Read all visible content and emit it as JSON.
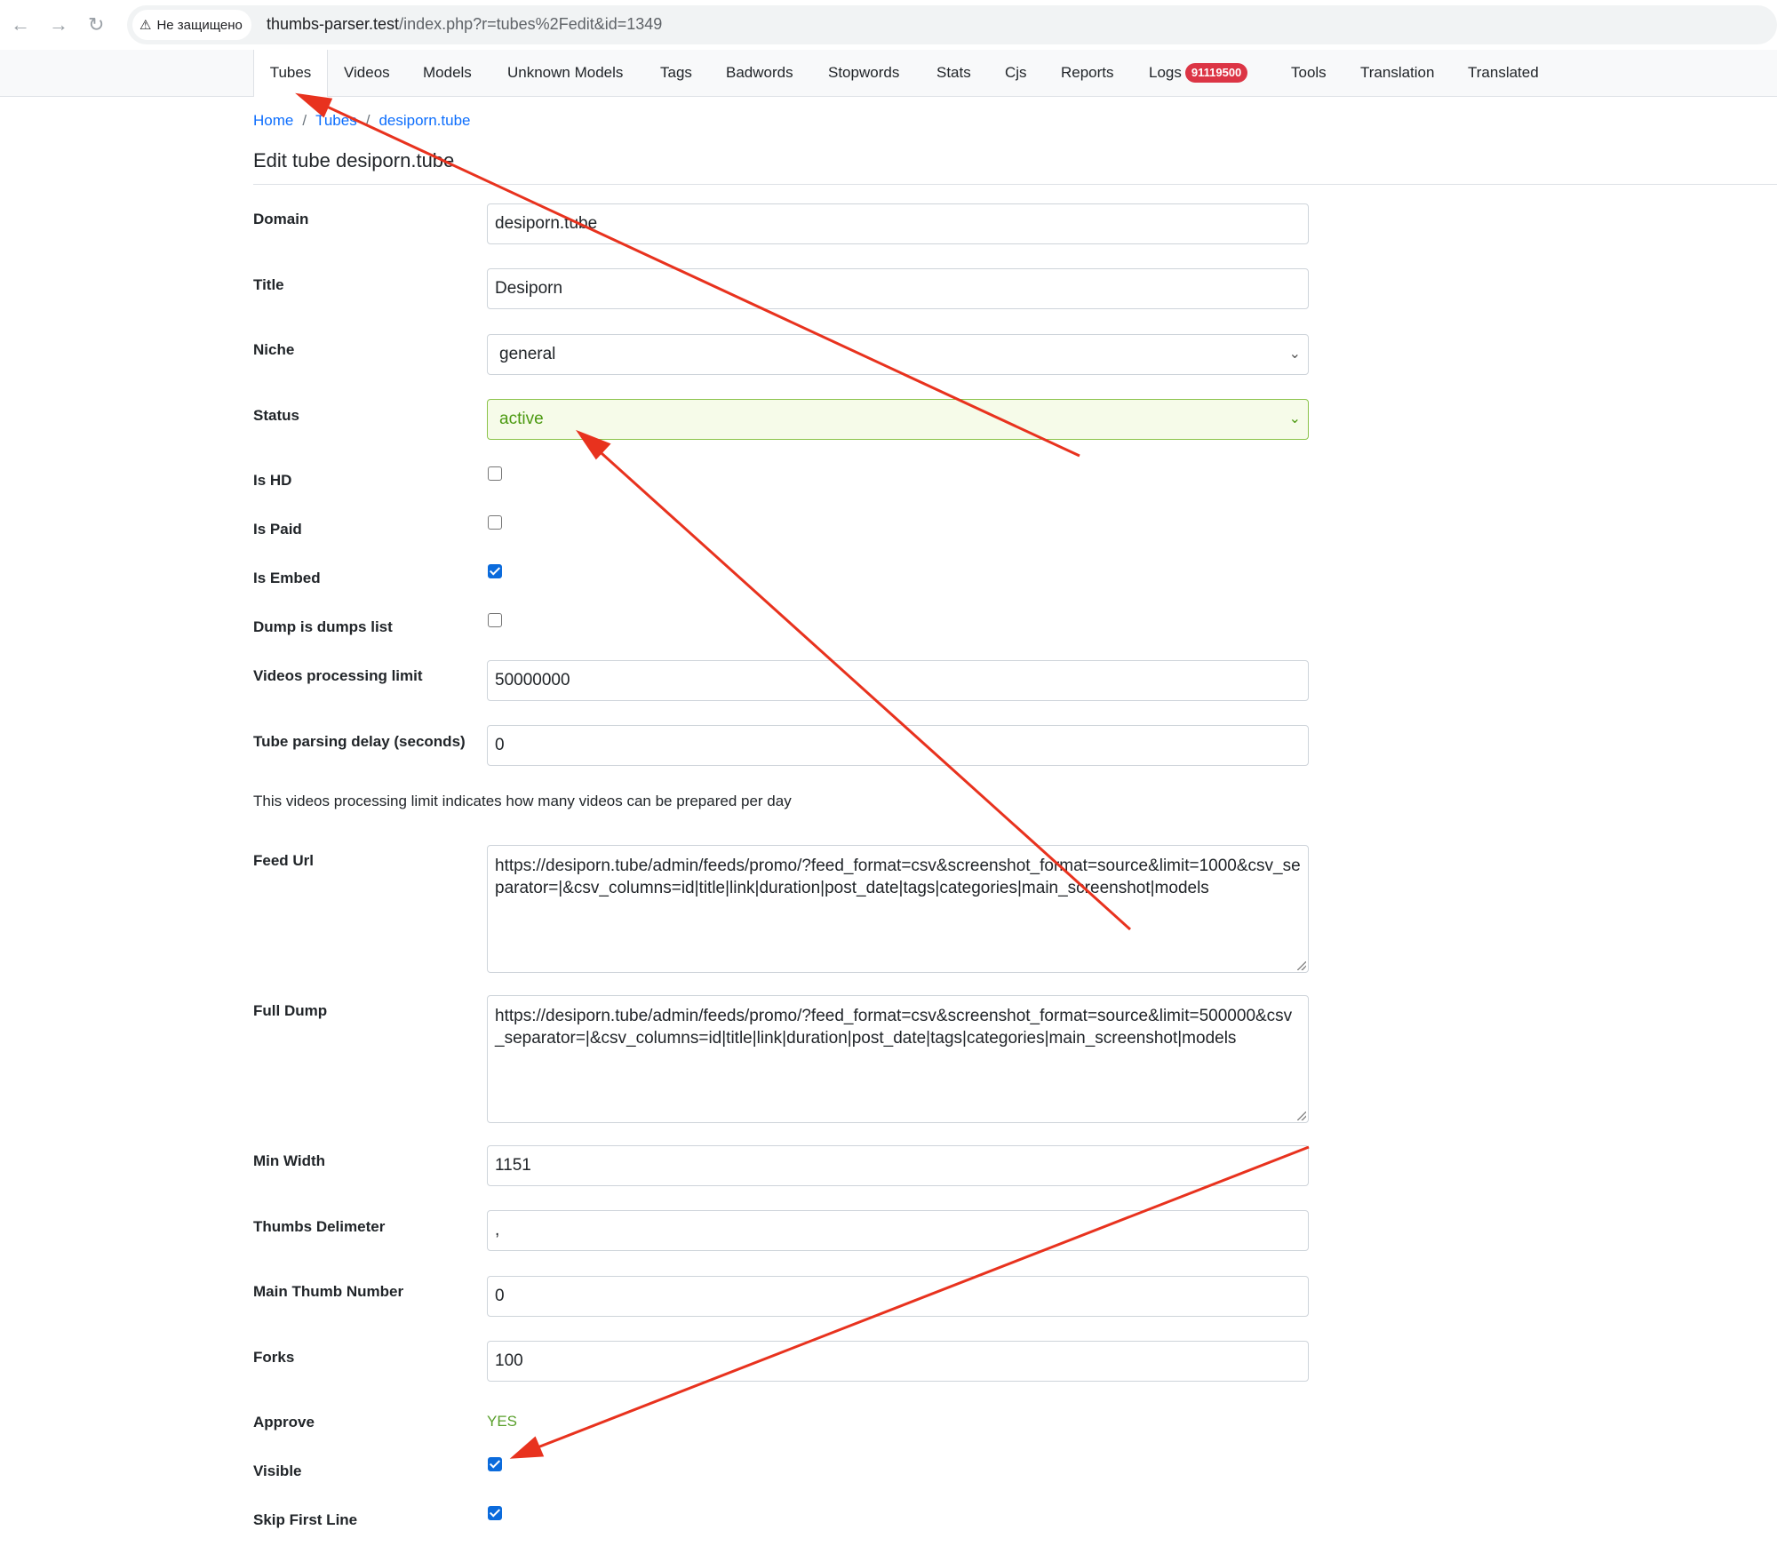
{
  "browser": {
    "security_label": "Не защищено",
    "url_host": "thumbs-parser.test",
    "url_path": "/index.php?r=tubes%2Fedit&id=1349"
  },
  "nav": {
    "tabs": [
      "Tubes",
      "Videos",
      "Models",
      "Unknown Models",
      "Tags",
      "Badwords",
      "Stopwords",
      "Stats",
      "Cjs",
      "Reports",
      "Logs",
      "Tools",
      "Translation",
      "Translated"
    ],
    "active_tab": "Tubes",
    "logs_badge": "91119500"
  },
  "breadcrumb": {
    "home": "Home",
    "tubes": "Tubes",
    "current": "desiporn.tube"
  },
  "page_title": "Edit tube desiporn.tube",
  "form": {
    "domain": {
      "label": "Domain",
      "value": "desiporn.tube"
    },
    "title": {
      "label": "Title",
      "value": "Desiporn"
    },
    "niche": {
      "label": "Niche",
      "value": "general"
    },
    "status": {
      "label": "Status",
      "value": "active"
    },
    "is_hd": {
      "label": "Is HD",
      "checked": false
    },
    "is_paid": {
      "label": "Is Paid",
      "checked": false
    },
    "is_embed": {
      "label": "Is Embed",
      "checked": true
    },
    "dump_is_dumps_list": {
      "label": "Dump is dumps list",
      "checked": false
    },
    "videos_processing_limit": {
      "label": "Videos processing limit",
      "value": "50000000"
    },
    "tube_parsing_delay": {
      "label": "Tube parsing delay (seconds)",
      "value": "0"
    },
    "help_text": "This videos processing limit indicates how many videos can be prepared per day",
    "feed_url": {
      "label": "Feed Url",
      "value": "https://desiporn.tube/admin/feeds/promo/?feed_format=csv&screenshot_format=source&limit=1000&csv_separator=|&csv_columns=id|title|link|duration|post_date|tags|categories|main_screenshot|models"
    },
    "full_dump": {
      "label": "Full Dump",
      "value": "https://desiporn.tube/admin/feeds/promo/?feed_format=csv&screenshot_format=source&limit=500000&csv_separator=|&csv_columns=id|title|link|duration|post_date|tags|categories|main_screenshot|models"
    },
    "min_width": {
      "label": "Min Width",
      "value": "1151"
    },
    "thumbs_delimeter": {
      "label": "Thumbs Delimeter",
      "value": ","
    },
    "main_thumb_number": {
      "label": "Main Thumb Number",
      "value": "0"
    },
    "forks": {
      "label": "Forks",
      "value": "100"
    },
    "approve": {
      "label": "Approve",
      "value": "YES"
    },
    "visible": {
      "label": "Visible",
      "checked": true
    },
    "skip_first_line": {
      "label": "Skip First Line",
      "checked": true
    }
  },
  "colors": {
    "annotation_arrow": "#e8321e",
    "link": "#0d6efd",
    "valid_green": "#4c9a12",
    "badge_red": "#dc3545",
    "checkbox_blue": "#0b6bdc"
  }
}
